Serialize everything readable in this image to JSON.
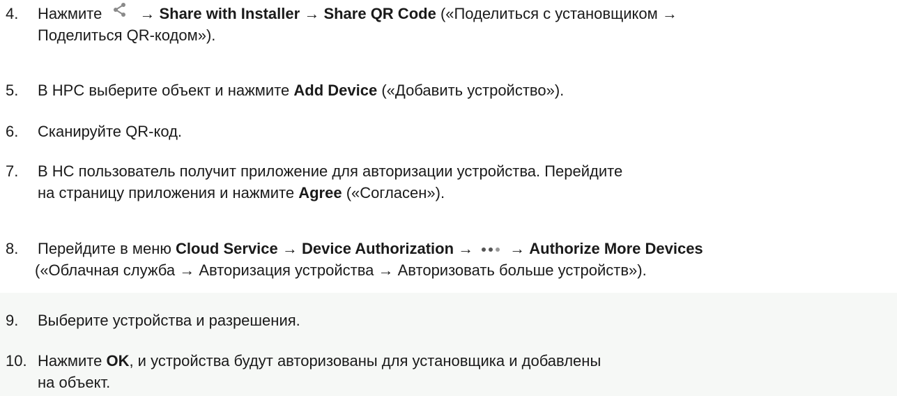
{
  "steps": [
    {
      "number": "4.",
      "line1": {
        "t1": "Нажмите",
        "icon": "share-icon",
        "t2": "→",
        "b1": "Share with Installer",
        "t3": "→",
        "b2": "Share QR Code",
        "t4": "(«Поделиться с установщиком →"
      },
      "line2": "Поделиться QR-кодом»)."
    },
    {
      "number": "5.",
      "t1": "В HPC выберите объект и нажмите",
      "b1": "Add Device",
      "t2": "(«Добавить устройство»)."
    },
    {
      "number": "6.",
      "t1": "Сканируйте QR-код."
    },
    {
      "number": "7.",
      "line1": "В HC пользователь получит приложение для авторизации устройства. Перейдите",
      "line2": {
        "t1": "на страницу приложения и нажмите",
        "b1": "Agree",
        "t2": "(«Согласен»)."
      }
    },
    {
      "number": "8.",
      "line1": {
        "t1": "Перейдите в меню",
        "b1": "Cloud Service",
        "t2": "→",
        "b2": "Device Authorization",
        "t3": "→",
        "icon": "more-dots-icon",
        "t4": "→",
        "b3": "Authorize More Devices"
      },
      "line2": "(«Облачная служба → Авторизация устройства → Авторизовать больше устройств»)."
    },
    {
      "number": "9.",
      "t1": "Выберите устройства и разрешения."
    },
    {
      "number": "10.",
      "line1": {
        "t1": "Нажмите",
        "b1": "OK",
        "t2": ", и устройства будут авторизованы для установщика и добавлены"
      },
      "line2": "на объект."
    }
  ],
  "colors": {
    "text": "#1a1a1a",
    "icon_gray": "#8a8a8a",
    "tinted_background": "#f6f8f6"
  }
}
